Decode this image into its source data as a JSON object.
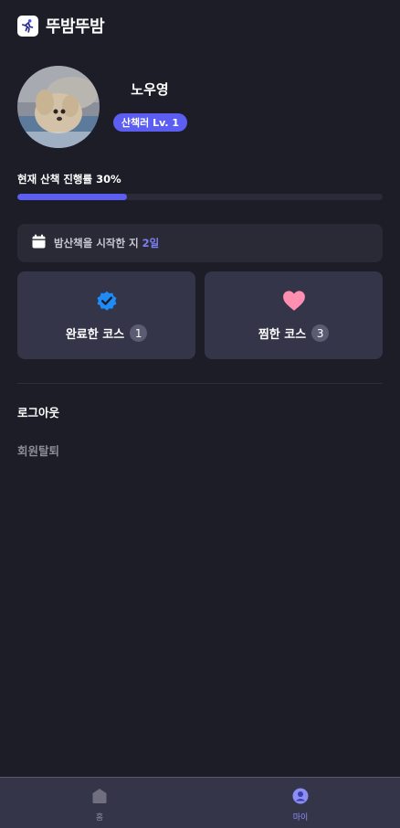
{
  "header": {
    "app_title": "뚜밤뚜밤",
    "logo_icon": "running-person-icon"
  },
  "profile": {
    "name": "노우영",
    "level_badge": "산책러 Lv. 1",
    "avatar_icon": "dog-photo"
  },
  "progress": {
    "label": "현재 산책 진행률 30%",
    "percent": 30
  },
  "walk_since": {
    "text": "밤산책을 시작한 지",
    "days": "2일"
  },
  "cards": [
    {
      "label": "완료한 코스",
      "count": "1",
      "icon": "verified-check-icon"
    },
    {
      "label": "찜한 코스",
      "count": "3",
      "icon": "heart-icon"
    }
  ],
  "menu": {
    "logout": "로그아웃",
    "withdraw": "회원탈퇴"
  },
  "bottom_nav": [
    {
      "label": "홈",
      "icon": "home-icon",
      "active": false
    },
    {
      "label": "마이",
      "icon": "user-icon",
      "active": true
    }
  ],
  "colors": {
    "accent": "#5b5ef0",
    "background": "#1d1d28",
    "card": "#35354a",
    "heart": "#ff8fb1",
    "verified": "#1d8cf8"
  }
}
